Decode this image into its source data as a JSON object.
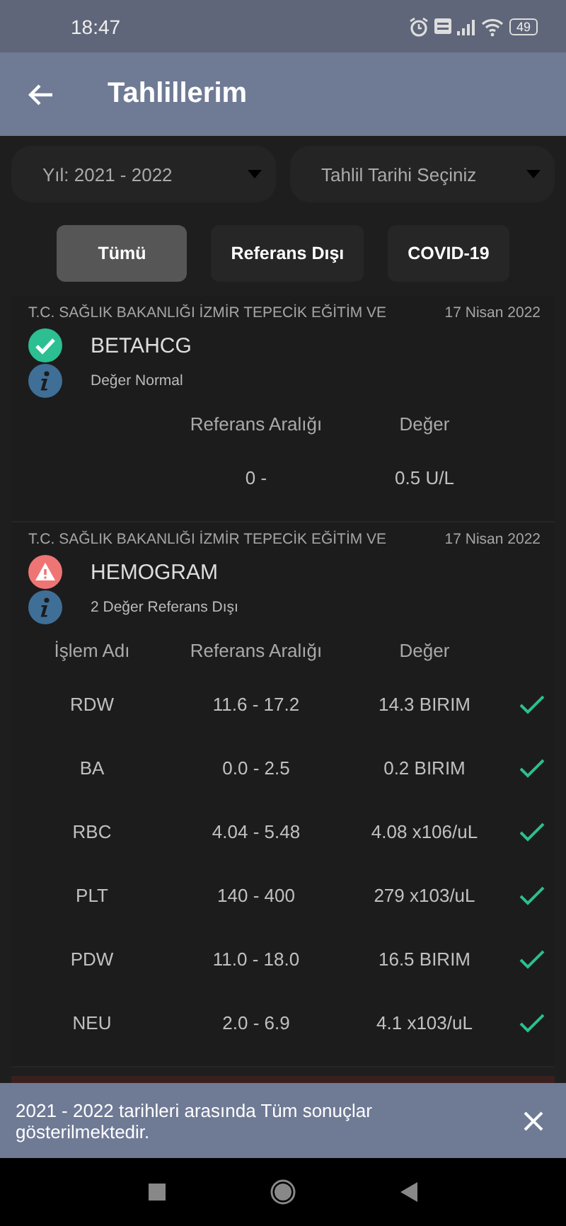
{
  "status_bar": {
    "time": "18:47",
    "battery": "49"
  },
  "app_bar": {
    "title": "Tahlillerim"
  },
  "filters": [
    {
      "label": "Yıl: 2021 - 2022"
    },
    {
      "label": "Tahlil Tarihi Seçiniz"
    }
  ],
  "chips": [
    {
      "label": "Tümü",
      "selected": true
    },
    {
      "label": "Referans Dışı",
      "selected": false
    },
    {
      "label": "COVID-19",
      "selected": false
    }
  ],
  "results": [
    {
      "institution": "T.C. SAĞLIK BAKANLIĞI İZMİR TEPECİK EĞİTİM VE",
      "date": "17 Nisan 2022",
      "title": "BETAHCG",
      "kind": "normal",
      "summary": "Değer Normal",
      "columns": [
        "Referans Aralığı",
        "Değer"
      ],
      "rows": [
        {
          "range": "0 -",
          "value": "0.5 U/L"
        }
      ]
    },
    {
      "institution": "T.C. SAĞLIK BAKANLIĞI İZMİR TEPECİK EĞİTİM VE",
      "date": "17 Nisan 2022",
      "title": "HEMOGRAM",
      "kind": "alert",
      "summary": "2 Değer Referans Dışı",
      "columns": [
        "İşlem Adı",
        "Referans Aralığı",
        "Değer"
      ],
      "rows": [
        {
          "name": "RDW",
          "range": "11.6 - 17.2",
          "value": "14.3 BIRIM",
          "in_range": true
        },
        {
          "name": "BA",
          "range": "0.0 - 2.5",
          "value": "0.2 BIRIM",
          "in_range": true
        },
        {
          "name": "RBC",
          "range": "4.04 - 5.48",
          "value": "4.08 x106/uL",
          "in_range": true
        },
        {
          "name": "PLT",
          "range": "140 - 400",
          "value": "279 x103/uL",
          "in_range": true
        },
        {
          "name": "PDW",
          "range": "11.0 - 18.0",
          "value": "16.5 BIRIM",
          "in_range": true
        },
        {
          "name": "NEU",
          "range": "2.0 - 6.9",
          "value": "4.1 x103/uL",
          "in_range": true
        }
      ]
    }
  ],
  "snackbar": {
    "message": "2021 - 2022 tarihleri arasında Tüm sonuçlar gösterilmektedir."
  }
}
